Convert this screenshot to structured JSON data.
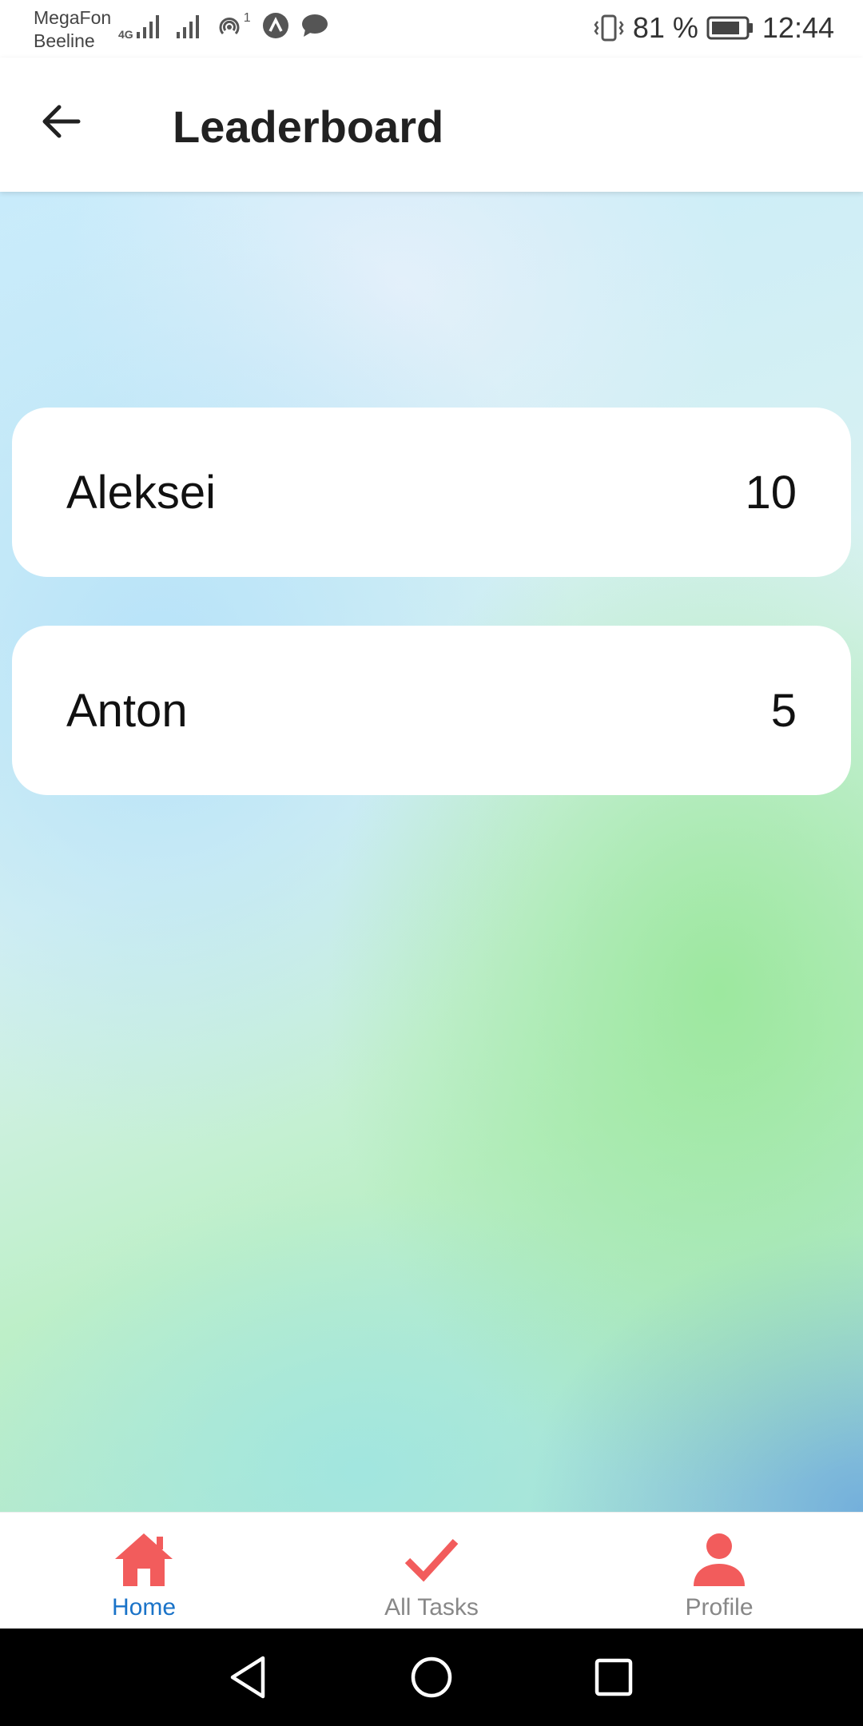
{
  "status_bar": {
    "carrier_1": "MegaFon",
    "carrier_2": "Beeline",
    "network_tag": "4G",
    "notification_count": "1",
    "battery_percent": "81 %",
    "time": "12:44"
  },
  "header": {
    "title": "Leaderboard"
  },
  "leaderboard": [
    {
      "name": "Aleksei",
      "score": "10"
    },
    {
      "name": "Anton",
      "score": "5"
    }
  ],
  "bottom_nav": {
    "items": [
      {
        "label": "Home",
        "icon": "home-icon",
        "active": true
      },
      {
        "label": "All Tasks",
        "icon": "check-icon",
        "active": false
      },
      {
        "label": "Profile",
        "icon": "person-icon",
        "active": false
      }
    ]
  },
  "colors": {
    "accent": "#f25c5c",
    "active_label": "#1a73c8",
    "inactive_label": "#888888"
  }
}
